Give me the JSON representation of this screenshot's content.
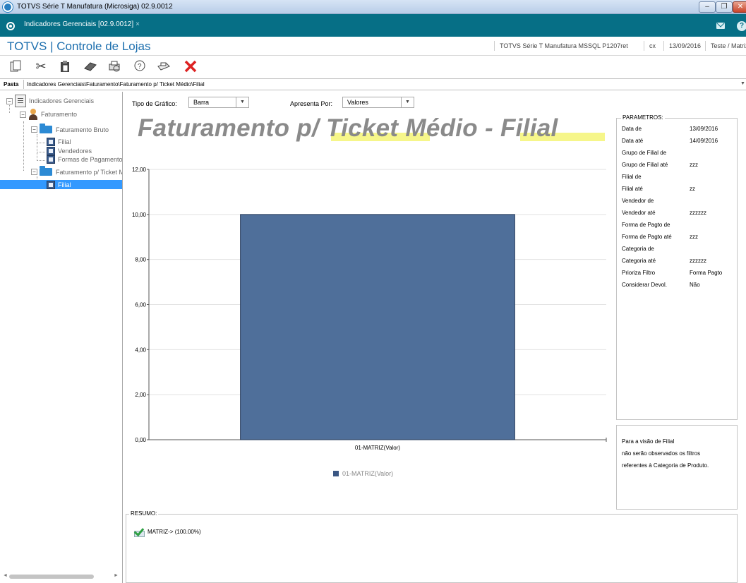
{
  "window": {
    "title": "TOTVS Série T Manufatura (Microsiga) 02.9.0012"
  },
  "tabs": [
    {
      "label": "Indicadores Gerenciais [02.9.0012]",
      "close": "×"
    }
  ],
  "header": {
    "app_title": "TOTVS | Controle de Lojas",
    "environment": "TOTVS Série T Manufatura MSSQL P1207ret",
    "user": "cx",
    "date": "13/09/2016",
    "company": "Teste / Matriz"
  },
  "toolbar": {
    "icons": [
      "copy-icon",
      "cut-icon",
      "paste-icon",
      "eraser-icon",
      "print-preview-icon",
      "help-icon",
      "printer-icon",
      "close-icon"
    ]
  },
  "path": {
    "label": "Pasta",
    "value": "Indicadores Gerenciais\\Faturamento\\Faturamento p/ Ticket Médio\\Filial"
  },
  "tree": {
    "root": "Indicadores Gerenciais",
    "faturamento": "Faturamento",
    "fat_bruto": "Faturamento Bruto",
    "fat_bruto_children": [
      "Filial",
      "Vendedores",
      "Formas de Pagamento"
    ],
    "fat_ticket": "Faturamento p/ Ticket Médio",
    "fat_ticket_children": [
      "Filial"
    ]
  },
  "controls": {
    "chart_type_label": "Tipo de Gráfico:",
    "chart_type_value": "Barra",
    "show_by_label": "Apresenta Por:",
    "show_by_value": "Valores"
  },
  "chart_title": "Faturamento p/ Ticket Médio - Filial",
  "chart_data": {
    "type": "bar",
    "title": "Faturamento p/ Ticket Médio - Filial",
    "categories": [
      "01-MATRIZ(Valor)"
    ],
    "series": [
      {
        "name": "01-MATRIZ(Valor)",
        "values": [
          10.0
        ]
      }
    ],
    "y_ticks": [
      "0,00",
      "2,00",
      "4,00",
      "6,00",
      "8,00",
      "10,00",
      "12,00"
    ],
    "ylim": [
      0,
      12
    ],
    "grid": true,
    "legend": "bottom",
    "bar_color": "#4f6f9a"
  },
  "parametros": {
    "title": "PARAMETROS:",
    "rows": [
      {
        "label": "Data de",
        "value": "13/09/2016"
      },
      {
        "label": "Data até",
        "value": "14/09/2016"
      },
      {
        "label": "Grupo de Filial de",
        "value": ""
      },
      {
        "label": "Grupo de Filial até",
        "value": "zzz"
      },
      {
        "label": "Filial de",
        "value": ""
      },
      {
        "label": "Filial até",
        "value": "zz"
      },
      {
        "label": "Vendedor de",
        "value": ""
      },
      {
        "label": "Vendedor até",
        "value": "zzzzzz"
      },
      {
        "label": "Forma de Pagto de",
        "value": ""
      },
      {
        "label": "Forma de Pagto até",
        "value": "zzz"
      },
      {
        "label": "Categoria de",
        "value": ""
      },
      {
        "label": "Categoria até",
        "value": "zzzzzz"
      },
      {
        "label": "Prioriza Filtro",
        "value": "Forma Pagto"
      },
      {
        "label": "Considerar Devol.",
        "value": "Não"
      }
    ]
  },
  "note": {
    "lines": [
      "Para a visão de Filial",
      "não serão observados os filtros",
      "referentes à Categoria de Produto."
    ]
  },
  "resumo": {
    "title": "RESUMO:",
    "item": "MATRIZ-> (100.00%)"
  }
}
